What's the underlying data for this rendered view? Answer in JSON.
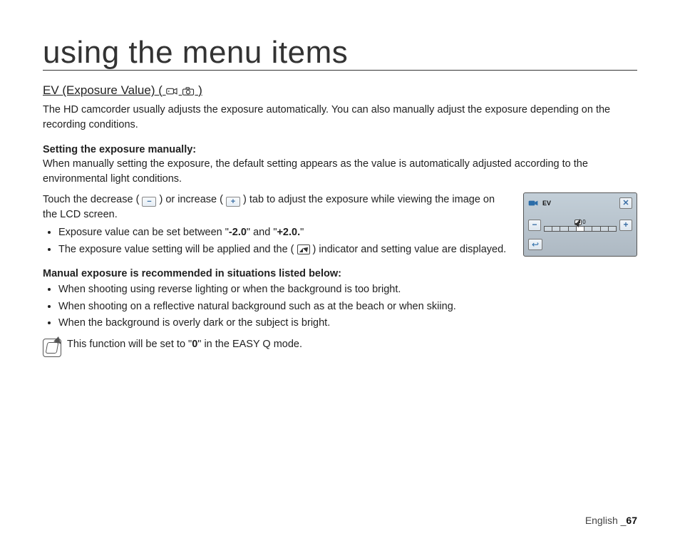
{
  "page": {
    "title": "using the menu items",
    "footer_lang": "English",
    "footer_sep": " _",
    "footer_page": "67"
  },
  "section": {
    "heading_pre": "EV (Exposure Value) (",
    "heading_post": ")",
    "intro": "The HD camcorder usually adjusts the exposure automatically. You can also manually adjust the exposure depending on the recording conditions."
  },
  "manual": {
    "heading": "Setting the exposure manually:",
    "desc": "When manually setting the exposure, the default setting appears as the value is automatically adjusted according to the environmental light conditions.",
    "instr_a": "Touch the decrease (",
    "instr_b": ") or increase (",
    "instr_c": ") tab to adjust the exposure while viewing the image on the LCD screen.",
    "bullets": [
      {
        "pre": "Exposure value can be set between \"",
        "b1": "-2.0",
        "mid": "\" and \"",
        "b2": "+2.0.",
        "post": "\""
      },
      {
        "pre": "The exposure value setting will be applied and the (",
        "post": ") indicator and setting value are displayed."
      }
    ]
  },
  "recommended": {
    "heading": "Manual exposure is recommended in situations listed below:",
    "items": [
      "When shooting using reverse lighting or when the background is too bright.",
      "When shooting on a reflective natural background such as at the beach or when skiing.",
      "When the background is overly dark or the subject is bright."
    ]
  },
  "note": {
    "pre": "This function will be set to \"",
    "bold": "0",
    "post": "\" in the EASY Q mode."
  },
  "lcd": {
    "title": "EV",
    "value_label_icon": "EV",
    "value": "0",
    "minus": "−",
    "plus": "+",
    "close": "✕",
    "back": "↩"
  },
  "icons": {
    "minus": "−",
    "plus": "+"
  }
}
